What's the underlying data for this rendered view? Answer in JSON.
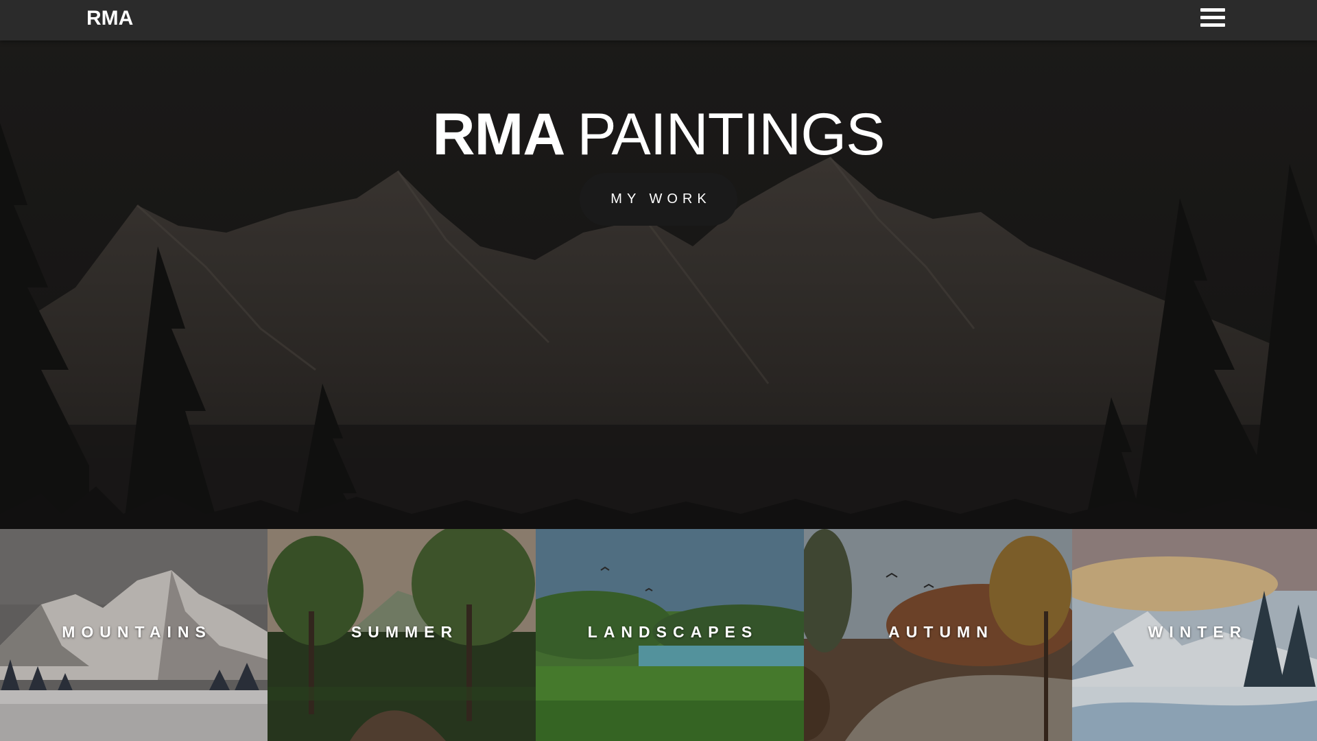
{
  "nav": {
    "brand": "RMA",
    "menu_icon": "hamburger-menu-icon"
  },
  "hero": {
    "title_strong": "RMA",
    "title_light": "PAINTINGS",
    "cta_label": "MY WORK"
  },
  "categories": [
    {
      "label": "MOUNTAINS"
    },
    {
      "label": "SUMMER"
    },
    {
      "label": "LANDSCAPES"
    },
    {
      "label": "AUTUMN"
    },
    {
      "label": "WINTER"
    }
  ],
  "colors": {
    "navbar_bg": "#2b2b2b",
    "hero_bg": "#252321",
    "cta_bg": "#1a1a1a",
    "text": "#ffffff"
  }
}
